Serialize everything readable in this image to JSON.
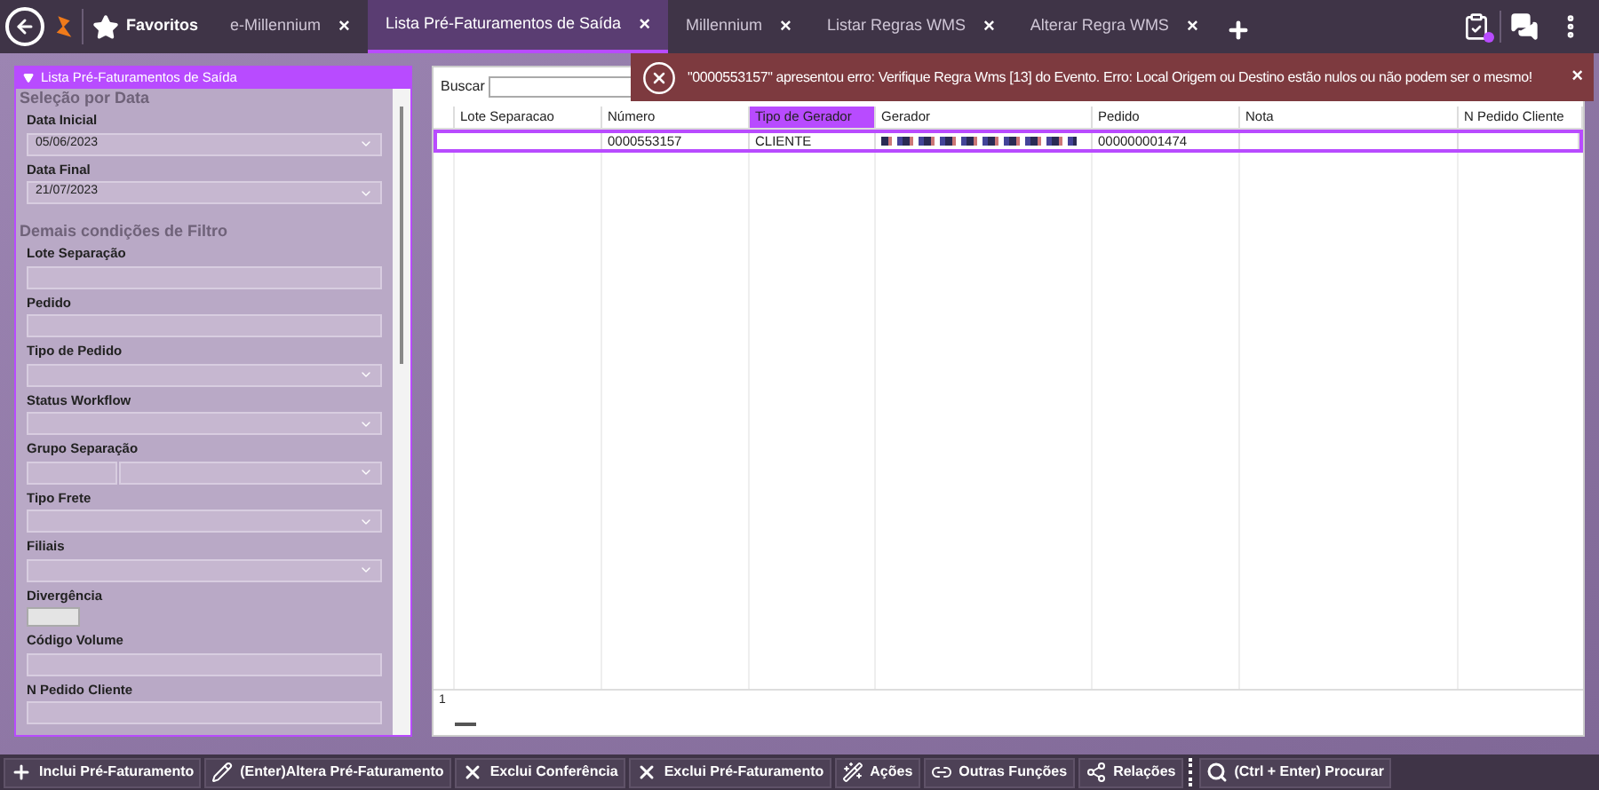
{
  "topbar": {
    "favorites": "Favoritos",
    "tabs": [
      {
        "label": "e-Millennium",
        "selected": false
      },
      {
        "label": "Lista Pré-Faturamentos de Saída",
        "selected": true
      },
      {
        "label": "Millennium",
        "selected": false
      },
      {
        "label": "Listar Regras WMS",
        "selected": false
      },
      {
        "label": "Alterar Regra WMS",
        "selected": false
      }
    ],
    "close_glyph": "×"
  },
  "filter_panel": {
    "title": "Lista Pré-Faturamentos de Saída",
    "sections": [
      {
        "title": "Seleção por Data",
        "fields": [
          {
            "label": "Data Inicial",
            "kind": "select",
            "value": "05/06/2023"
          },
          {
            "label": "Data Final",
            "kind": "select",
            "value": "21/07/2023"
          }
        ]
      },
      {
        "title": "Demais condições de Filtro",
        "fields": [
          {
            "label": "Lote Separação",
            "kind": "text"
          },
          {
            "label": "Pedido",
            "kind": "text"
          },
          {
            "label": "Tipo de Pedido",
            "kind": "select"
          },
          {
            "label": "Status Workflow",
            "kind": "select"
          },
          {
            "label": "Grupo Separação",
            "kind": "split"
          },
          {
            "label": "Tipo Frete",
            "kind": "select"
          },
          {
            "label": "Filiais",
            "kind": "select"
          },
          {
            "label": "Divergência",
            "kind": "checkbox",
            "checked": false
          },
          {
            "label": "Código Volume",
            "kind": "text"
          },
          {
            "label": "N Pedido Cliente",
            "kind": "text"
          }
        ]
      }
    ]
  },
  "grid": {
    "search_label": "Buscar",
    "columns": [
      {
        "label": "Lote Separacao",
        "selected": false
      },
      {
        "label": "Número",
        "selected": false
      },
      {
        "label": "Tipo de Gerador",
        "selected": true
      },
      {
        "label": "Gerador",
        "selected": false
      },
      {
        "label": "Pedido",
        "selected": false
      },
      {
        "label": "Nota",
        "selected": false
      },
      {
        "label": "N Pedido Cliente",
        "selected": false
      }
    ],
    "rows": [
      {
        "selected": true,
        "cells": [
          "",
          "0000553157",
          "CLIENTE",
          "",
          "000000001474",
          "",
          ""
        ]
      }
    ],
    "footer_count": "1"
  },
  "error_toast": {
    "message": "\"0000553157\" apresentou erro: Verifique Regra Wms [13] do Evento. Erro: Local Origem ou Destino estão nulos ou não podem ser o mesmo!",
    "close_glyph": "×"
  },
  "toolbar": [
    {
      "label": "Inclui Pré-Faturamento",
      "kind": "plus"
    },
    {
      "label": "(Enter)Altera Pré-Faturamento",
      "kind": "pencil"
    },
    {
      "label": "Exclui Conferência",
      "kind": "x"
    },
    {
      "label": "Exclui Pré-Faturamento",
      "kind": "x"
    },
    {
      "label": "Ações",
      "kind": "wand"
    },
    {
      "label": "Outras Funções",
      "kind": "link"
    },
    {
      "label": "Relações",
      "kind": "nodes"
    },
    {
      "label": "(Ctrl + Enter) Procurar",
      "kind": "search"
    }
  ]
}
